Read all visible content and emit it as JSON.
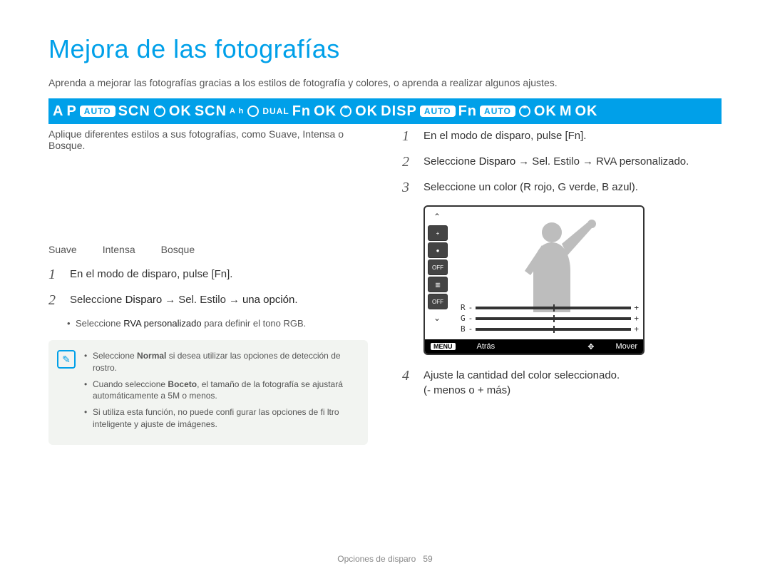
{
  "title": "Mejora de las fotografías",
  "intro": "Aprenda a mejorar las fotografías gracias a los estilos de fotografía y colores, o aprenda a realizar algunos ajustes.",
  "mode_bar": {
    "tokens": [
      "A",
      "P",
      "AUTO",
      "SCN",
      "OK",
      "SCN",
      "A h",
      "DUAL",
      "Fn",
      "OK",
      "OK",
      "DISP",
      "AUTO",
      "Fn",
      "AUTO",
      "OK",
      "M",
      "OK"
    ]
  },
  "left": {
    "sub": "Aplique diferentes estilos a sus fotografías, como Suave, Intensa o Bosque.",
    "styles": [
      "Suave",
      "Intensa",
      "Bosque"
    ],
    "steps": [
      {
        "num": "1",
        "text_lead": "En el modo de disparo, pulse [",
        "btn": "Fn",
        "text_trail": "]."
      },
      {
        "num": "2",
        "text_lead": "Seleccione ",
        "strong1": "Disparo",
        "arrow1": "→",
        "mid1": "Sel. Estilo",
        "arrow2": "→",
        "strong2": "una opción",
        "trail": "."
      }
    ],
    "sub_bullet": {
      "lead": "Seleccione ",
      "strong": "RVA personalizado",
      "trail": " para definir el tono RGB."
    },
    "notes": [
      {
        "lead": "Seleccione ",
        "strong": "Normal",
        "trail": " si desea utilizar las opciones de detección de rostro."
      },
      {
        "lead": "Cuando seleccione ",
        "strong": "Boceto",
        "trail": ", el tamaño de la fotografía se ajustará automáticamente a 5M o menos."
      },
      {
        "full": "Si utiliza esta función, no puede confi gurar las opciones de fi ltro inteligente y ajuste de imágenes."
      }
    ]
  },
  "right": {
    "steps": [
      {
        "num": "1",
        "text_lead": "En el modo de disparo, pulse [",
        "btn": "Fn",
        "text_trail": "]."
      },
      {
        "num": "2",
        "text_lead": "Seleccione ",
        "strong1": "Disparo",
        "arrow1": "→",
        "mid1": "Sel. Estilo",
        "arrow2": "→",
        "mid2": "RVA personalizado",
        "trail": "."
      },
      {
        "num": "3",
        "full": "Seleccione un color (R rojo, G verde, B azul)."
      },
      {
        "num": "4",
        "line1": "Ajuste la cantidad del color seleccionado.",
        "line2": "(- menos o + más)"
      }
    ],
    "lcd": {
      "icons": [
        "⌃",
        "+",
        "●",
        "OFF",
        "▥",
        "OFF",
        "⌄"
      ],
      "sliders": [
        {
          "label": "R",
          "minus": "-",
          "plus": "+"
        },
        {
          "label": "G",
          "minus": "-",
          "plus": "+"
        },
        {
          "label": "B",
          "minus": "-",
          "plus": "+"
        }
      ],
      "footer": {
        "menu_badge": "MENU",
        "back": "Atrás",
        "move_icon": "✥",
        "move": "Mover"
      }
    }
  },
  "footer": {
    "section": "Opciones de disparo",
    "page": "59"
  }
}
